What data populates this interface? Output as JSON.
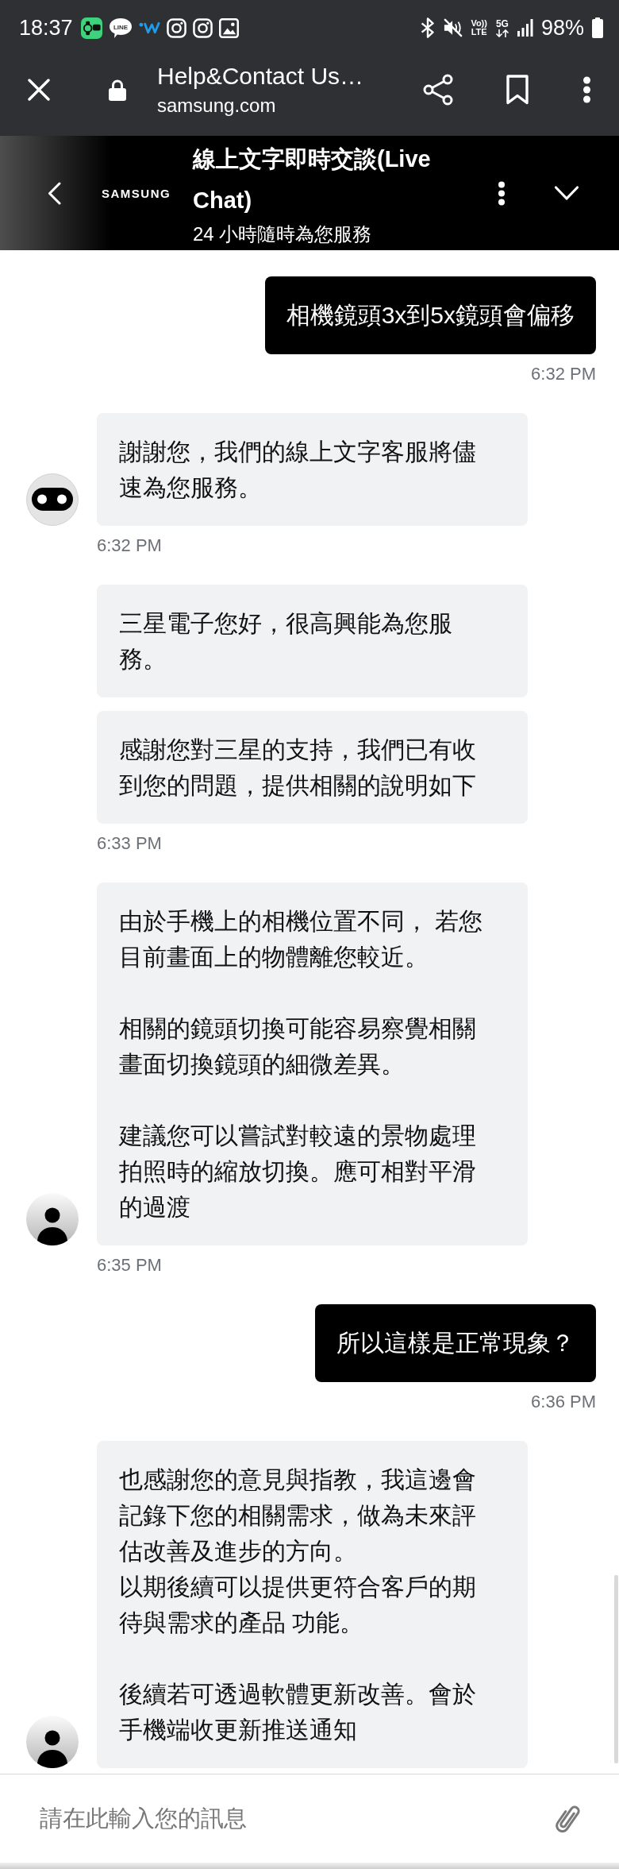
{
  "status_bar": {
    "time": "18:37",
    "line_badge": "LINE",
    "volte": [
      "Vo))",
      "LTE"
    ],
    "network": "5G",
    "battery": "98%"
  },
  "browser_toolbar": {
    "title": "Help&Contact Us…",
    "url": "samsung.com"
  },
  "chat_header": {
    "logo": "SAMSUNG",
    "title": "線上文字即時交談(Live Chat)",
    "subtitle": "24 小時隨時為您服務"
  },
  "messages": [
    {
      "kind": "sent",
      "text": "相機鏡頭3x到5x鏡頭會偏移",
      "time": "6:32 PM"
    },
    {
      "kind": "received",
      "avatar": {
        "kind": "bot"
      },
      "paragraphs": [
        [
          "謝謝您，我們的線上文字客服將儘速為您服務。"
        ]
      ],
      "time": "6:32 PM"
    },
    {
      "kind": "received",
      "paragraphs": [
        [
          "三星電子您好，很高興能為您服務。"
        ]
      ]
    },
    {
      "kind": "received",
      "paragraphs": [
        [
          "感謝您對三星的支持，我們已有收到您的問題，提供相關的說明如下"
        ]
      ],
      "time": "6:33 PM"
    },
    {
      "kind": "received",
      "avatar": {
        "kind": "person"
      },
      "paragraphs": [
        [
          "由於手機上的相機位置不同， 若您目前畫面上的物體離您較近。"
        ],
        [
          "相關的鏡頭切換可能容易察覺相關畫面切換鏡頭的細微差異。"
        ],
        [
          "建議您可以嘗試對較遠的景物處理拍照時的縮放切換。應可相對平滑的過渡"
        ]
      ],
      "time": "6:35 PM"
    },
    {
      "kind": "sent",
      "text": "所以這樣是正常現象？",
      "time": "6:36 PM"
    },
    {
      "kind": "received",
      "avatar": {
        "kind": "person"
      },
      "paragraphs": [
        [
          "也感謝您的意見與指教，我這邊會記錄下您的相關需求，做為未來評估改善及進步的方向。",
          "以期後續可以提供更符合客戶的期待與需求的產品 功能。"
        ],
        [
          "後續若可透過軟體更新改善。會於手機端收更新推送通知"
        ]
      ]
    }
  ],
  "composer": {
    "placeholder": "請在此輸入您的訊息"
  }
}
